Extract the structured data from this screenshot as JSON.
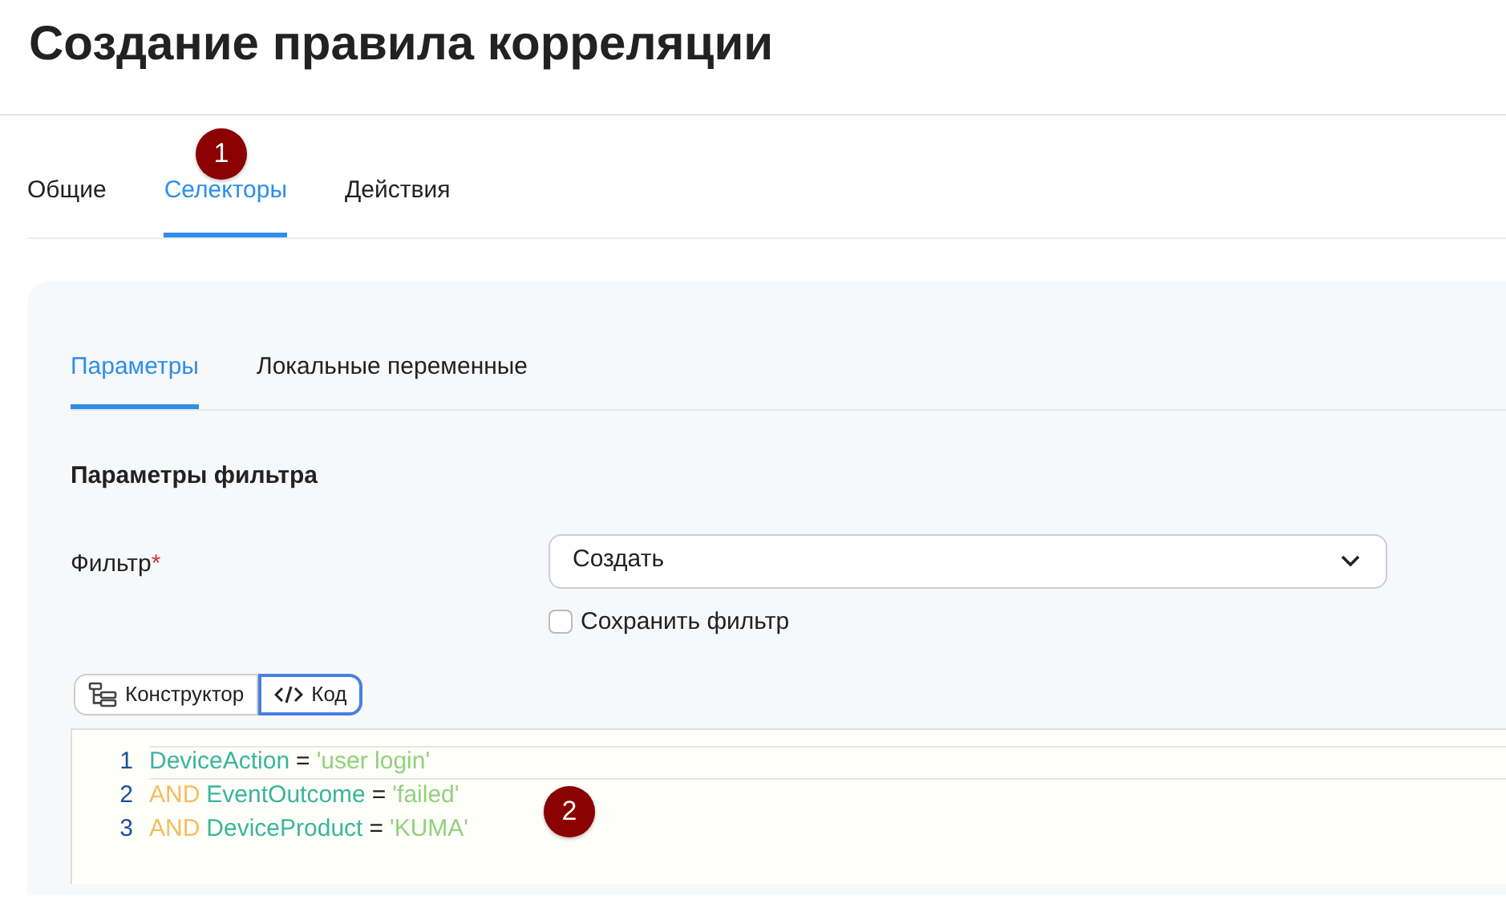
{
  "title": "Создание правила корреляции",
  "tabs": [
    {
      "label": "Общие",
      "selected": false
    },
    {
      "label": "Селекторы",
      "selected": true
    },
    {
      "label": "Действия",
      "selected": false
    }
  ],
  "subtabs": [
    {
      "label": "Параметры",
      "selected": true
    },
    {
      "label": "Локальные переменные",
      "selected": false
    }
  ],
  "section_title": "Параметры фильтра",
  "filter": {
    "label": "Фильтр",
    "required": true,
    "required_mark": "*",
    "value": "Создать"
  },
  "save_filter": {
    "label": "Сохранить фильтр",
    "checked": false
  },
  "mode_buttons": [
    {
      "label": "Конструктор",
      "kind": "tree",
      "selected": false
    },
    {
      "label": "Код",
      "kind": "code",
      "selected": true
    }
  ],
  "code_lines": [
    {
      "number": "1",
      "highlighted": true,
      "tokens": [
        {
          "kind": "field",
          "text": "DeviceAction"
        },
        {
          "kind": "op",
          "text": "="
        },
        {
          "kind": "string",
          "text": "'user login'"
        }
      ]
    },
    {
      "number": "2",
      "highlighted": false,
      "tokens": [
        {
          "kind": "keyword",
          "text": "AND"
        },
        {
          "kind": "field",
          "text": "EventOutcome"
        },
        {
          "kind": "op",
          "text": "="
        },
        {
          "kind": "string",
          "text": "'failed'"
        }
      ]
    },
    {
      "number": "3",
      "highlighted": false,
      "tokens": [
        {
          "kind": "keyword",
          "text": "AND"
        },
        {
          "kind": "field",
          "text": "DeviceProduct"
        },
        {
          "kind": "op",
          "text": "="
        },
        {
          "kind": "string",
          "text": "'KUMA'"
        }
      ]
    }
  ],
  "markers": [
    "1",
    "2"
  ]
}
